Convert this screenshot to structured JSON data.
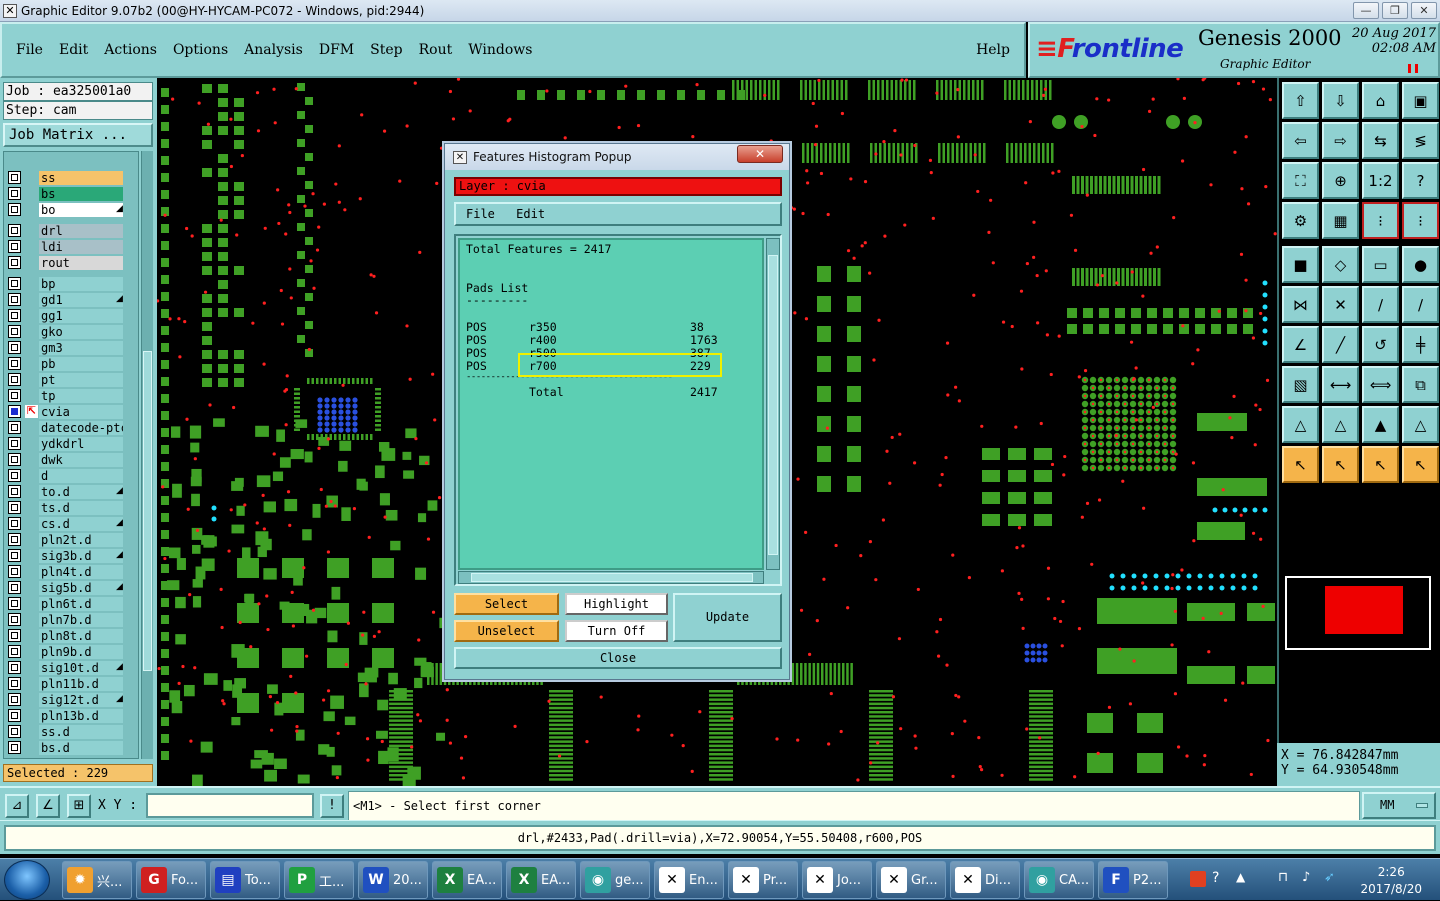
{
  "window": {
    "title": "Graphic Editor 9.07b2 (00@HY-HYCAM-PC072 - Windows, pid:2944)",
    "minimize": "—",
    "restore": "❐",
    "close": "✕"
  },
  "menu": {
    "items": [
      "File",
      "Edit",
      "Actions",
      "Options",
      "Analysis",
      "DFM",
      "Step",
      "Rout",
      "Windows"
    ],
    "help": "Help"
  },
  "brand": {
    "logo_f": "≡F",
    "logo_rest": "rontline",
    "product": "Genesis 2000",
    "subtitle": "Graphic Editor",
    "date": "20  Aug 2017",
    "time": "02:08  AM"
  },
  "left": {
    "job": "Job : ea325001a0",
    "step": "Step: cam",
    "job_matrix": "Job Matrix ...",
    "selected": "Selected : 229",
    "layers": [
      {
        "name": "ss",
        "color": "#f5c36a"
      },
      {
        "name": "bs",
        "color": "#2aa878"
      },
      {
        "name": "bo",
        "color": "#ffffff",
        "arrow": true
      },
      {
        "name": "drl",
        "color": "#a8c0c8"
      },
      {
        "name": "ldi",
        "color": "#a8c0c8"
      },
      {
        "name": "rout",
        "color": "#d8d8d8"
      },
      {
        "name": "bp",
        "color": "#8fd1d1"
      },
      {
        "name": "gd1",
        "color": "#8fd1d1",
        "arrow": true
      },
      {
        "name": "gg1",
        "color": "#8fd1d1"
      },
      {
        "name": "gko",
        "color": "#8fd1d1"
      },
      {
        "name": "gm3",
        "color": "#8fd1d1"
      },
      {
        "name": "pb",
        "color": "#8fd1d1"
      },
      {
        "name": "pt",
        "color": "#8fd1d1"
      },
      {
        "name": "tp",
        "color": "#8fd1d1"
      },
      {
        "name": "cvia",
        "color": "#8fd1d1",
        "active": true
      },
      {
        "name": "datecode-ptc",
        "color": "#8fd1d1"
      },
      {
        "name": "ydkdrl",
        "color": "#8fd1d1"
      },
      {
        "name": "dwk",
        "color": "#8fd1d1"
      },
      {
        "name": "d",
        "color": "#8fd1d1"
      },
      {
        "name": "to.d",
        "color": "#8fd1d1",
        "arrow": true
      },
      {
        "name": "ts.d",
        "color": "#8fd1d1"
      },
      {
        "name": "cs.d",
        "color": "#8fd1d1",
        "arrow": true
      },
      {
        "name": "pln2t.d",
        "color": "#8fd1d1"
      },
      {
        "name": "sig3b.d",
        "color": "#8fd1d1",
        "arrow": true
      },
      {
        "name": "pln4t.d",
        "color": "#8fd1d1"
      },
      {
        "name": "sig5b.d",
        "color": "#8fd1d1",
        "arrow": true
      },
      {
        "name": "pln6t.d",
        "color": "#8fd1d1"
      },
      {
        "name": "pln7b.d",
        "color": "#8fd1d1"
      },
      {
        "name": "pln8t.d",
        "color": "#8fd1d1"
      },
      {
        "name": "pln9b.d",
        "color": "#8fd1d1"
      },
      {
        "name": "sig10t.d",
        "color": "#8fd1d1",
        "arrow": true
      },
      {
        "name": "pln11b.d",
        "color": "#8fd1d1"
      },
      {
        "name": "sig12t.d",
        "color": "#8fd1d1",
        "arrow": true
      },
      {
        "name": "pln13b.d",
        "color": "#8fd1d1"
      },
      {
        "name": "ss.d",
        "color": "#8fd1d1"
      },
      {
        "name": "bs.d",
        "color": "#8fd1d1"
      }
    ]
  },
  "popup": {
    "title": "Features Histogram Popup",
    "close": "✕",
    "layer_label": "Layer :  cvia",
    "menu": [
      "File",
      "Edit"
    ],
    "total_features": "Total Features = 2417",
    "pads_list": "Pads List",
    "pads_rule": "---------",
    "rows": [
      {
        "pol": "POS",
        "sym": "r350",
        "count": "38"
      },
      {
        "pol": "POS",
        "sym": "r400",
        "count": "1763"
      },
      {
        "pol": "POS",
        "sym": "r500",
        "count": "387"
      },
      {
        "pol": "POS",
        "sym": "r700",
        "count": "229"
      }
    ],
    "separator": "------------------------------------------",
    "total_label": "Total",
    "total_value": "2417",
    "buttons": {
      "select": "Select",
      "highlight": "Highlight",
      "update": "Update",
      "unselect": "Unselect",
      "turn_off": "Turn Off",
      "close": "Close"
    }
  },
  "right": {
    "x": "X  =  76.842847mm",
    "y": "Y  =  64.930548mm"
  },
  "command": {
    "xy_label": "X Y :",
    "xy_value": "",
    "prompt": "<M1> - Select first corner",
    "units": "MM"
  },
  "status": {
    "line": "drl,#2433,Pad(.drill=via),X=72.90054,Y=55.50408,r600,POS"
  },
  "taskbar": {
    "items": [
      {
        "label": "兴...",
        "color": "#f0a030",
        "glyph": "✹"
      },
      {
        "label": "Fo...",
        "color": "#d02020",
        "glyph": "G"
      },
      {
        "label": "To...",
        "color": "#2040c0",
        "glyph": "▤"
      },
      {
        "label": "工...",
        "color": "#20a040",
        "glyph": "P"
      },
      {
        "label": "20...",
        "color": "#2050c0",
        "glyph": "W"
      },
      {
        "label": "EA...",
        "color": "#1e8040",
        "glyph": "X"
      },
      {
        "label": "EA...",
        "color": "#1e8040",
        "glyph": "X"
      },
      {
        "label": "ge...",
        "color": "#30a0a0",
        "glyph": "◉"
      },
      {
        "label": "En...",
        "color": "#ffffff",
        "glyph": "✕"
      },
      {
        "label": "Pr...",
        "color": "#ffffff",
        "glyph": "✕"
      },
      {
        "label": "Jo...",
        "color": "#ffffff",
        "glyph": "✕"
      },
      {
        "label": "Gr...",
        "color": "#ffffff",
        "glyph": "✕"
      },
      {
        "label": "Di...",
        "color": "#ffffff",
        "glyph": "✕"
      },
      {
        "label": "CA...",
        "color": "#30a0a0",
        "glyph": "◉"
      },
      {
        "label": "P2...",
        "color": "#2050c0",
        "glyph": "F"
      }
    ],
    "time": "2:26",
    "date": "2017/8/20"
  }
}
